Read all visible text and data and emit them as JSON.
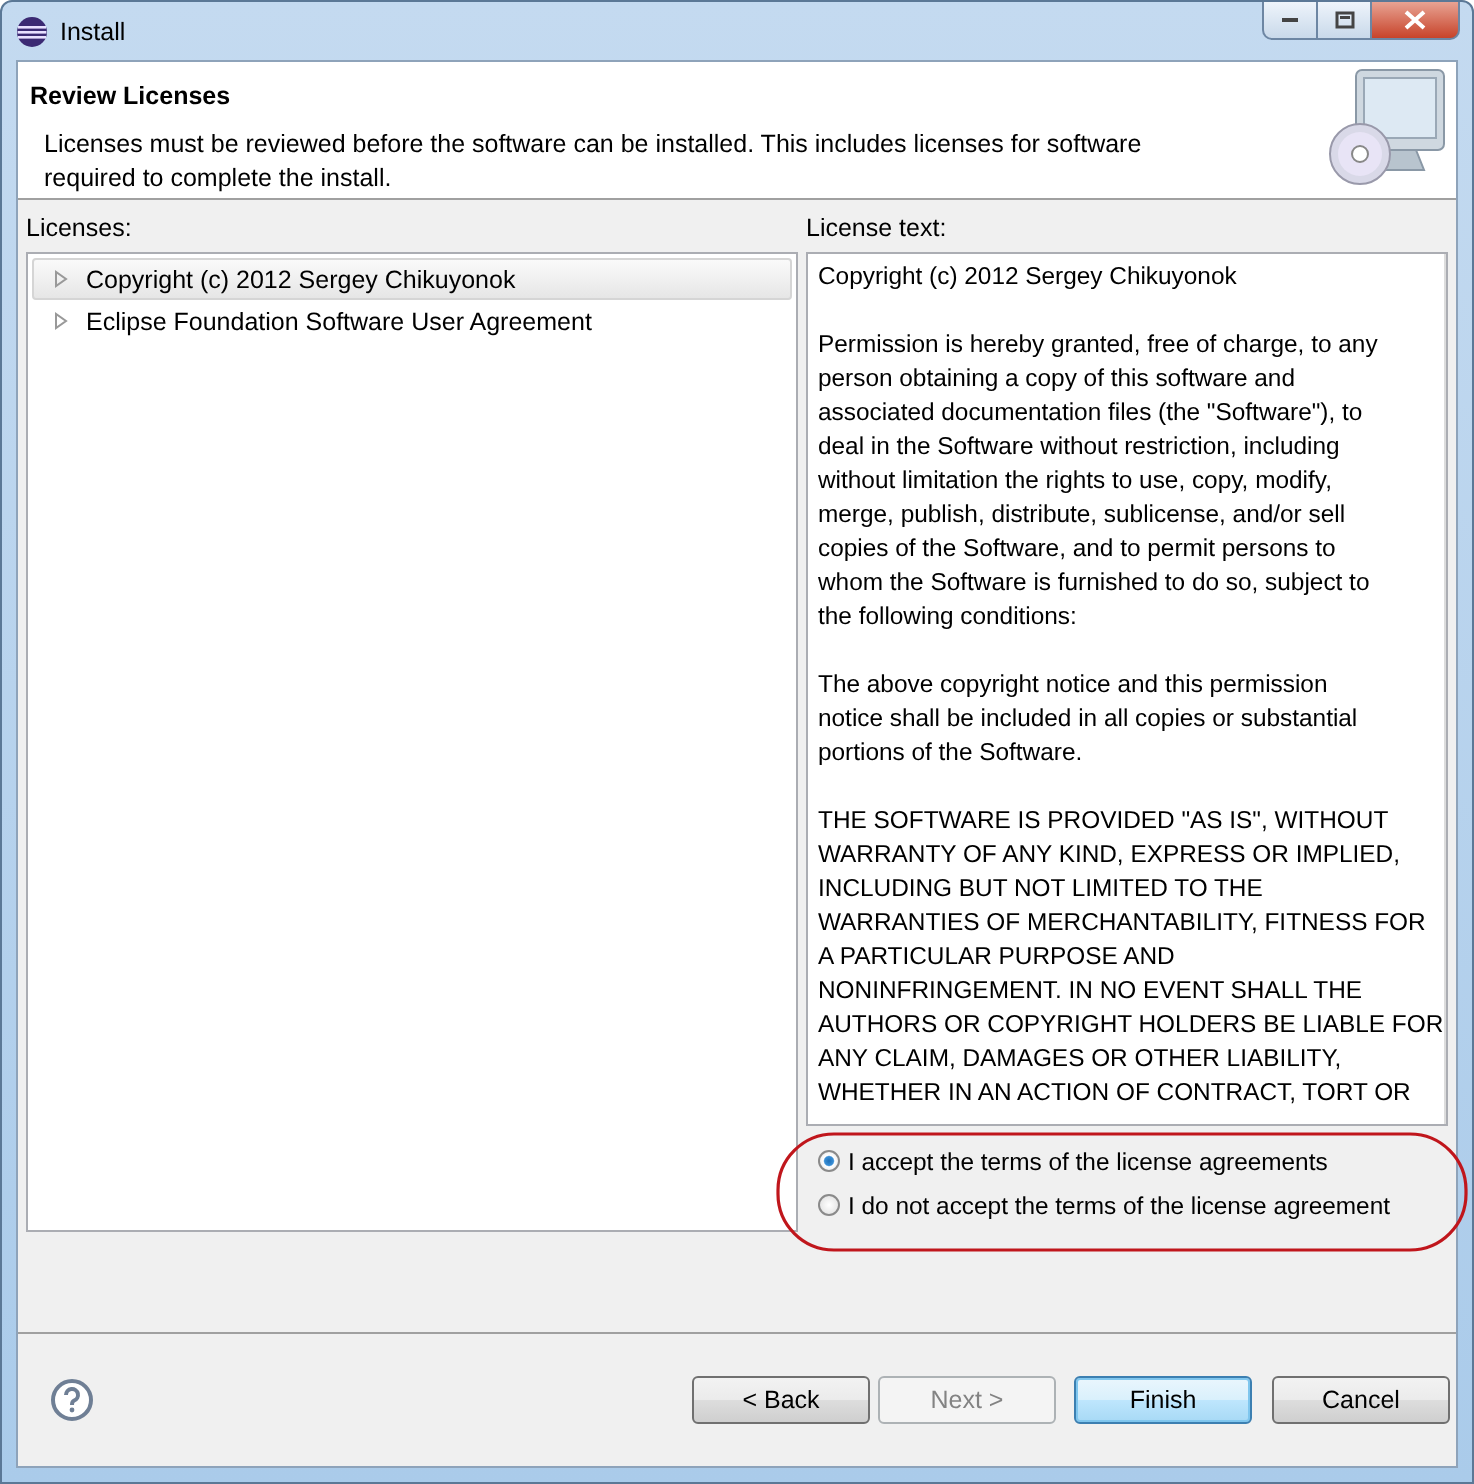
{
  "window": {
    "title": "Install"
  },
  "header": {
    "title": "Review Licenses",
    "description": "Licenses must be reviewed before the software can be installed.  This includes licenses for software required to complete the install."
  },
  "licenses": {
    "label": "Licenses:",
    "items": [
      {
        "label": "Copyright (c) 2012 Sergey Chikuyonok",
        "selected": true,
        "expanded": false
      },
      {
        "label": "Eclipse Foundation Software User Agreement",
        "selected": false,
        "expanded": false
      }
    ]
  },
  "license_text": {
    "label": "License text:",
    "paragraphs": [
      [
        "Copyright (c) 2012 Sergey Chikuyonok"
      ],
      [
        "Permission is hereby granted, free of charge, to any",
        "person obtaining a copy of this software and",
        "associated documentation files (the \"Software\"), to",
        "deal in the Software without restriction, including",
        "without limitation the rights to use, copy, modify,",
        "merge, publish, distribute, sublicense, and/or sell",
        "copies of the Software, and to permit persons to",
        "whom the Software is furnished to do so, subject to",
        "the following conditions:"
      ],
      [
        "The above copyright notice and this permission",
        "notice shall be included in all copies or substantial",
        "portions of the Software."
      ],
      [
        "THE SOFTWARE IS PROVIDED \"AS IS\", WITHOUT",
        "WARRANTY OF ANY KIND, EXPRESS OR IMPLIED,",
        "INCLUDING BUT NOT LIMITED TO THE",
        "WARRANTIES OF MERCHANTABILITY, FITNESS FOR",
        "A PARTICULAR PURPOSE AND",
        "NONINFRINGEMENT. IN NO EVENT SHALL THE",
        "AUTHORS OR COPYRIGHT HOLDERS BE LIABLE FOR",
        "ANY CLAIM, DAMAGES OR OTHER LIABILITY,",
        "WHETHER IN AN ACTION OF CONTRACT, TORT OR"
      ]
    ]
  },
  "options": [
    {
      "label": "I accept the terms of the license agreements",
      "selected": true
    },
    {
      "label": "I do not accept the terms of the license agreement",
      "selected": false
    }
  ],
  "buttons": [
    {
      "label": "< Back",
      "disabled": false,
      "default": false
    },
    {
      "label": "Next >",
      "disabled": true,
      "default": false
    },
    {
      "label": "Finish",
      "disabled": false,
      "default": true
    },
    {
      "label": "Cancel",
      "disabled": false,
      "default": false
    }
  ]
}
